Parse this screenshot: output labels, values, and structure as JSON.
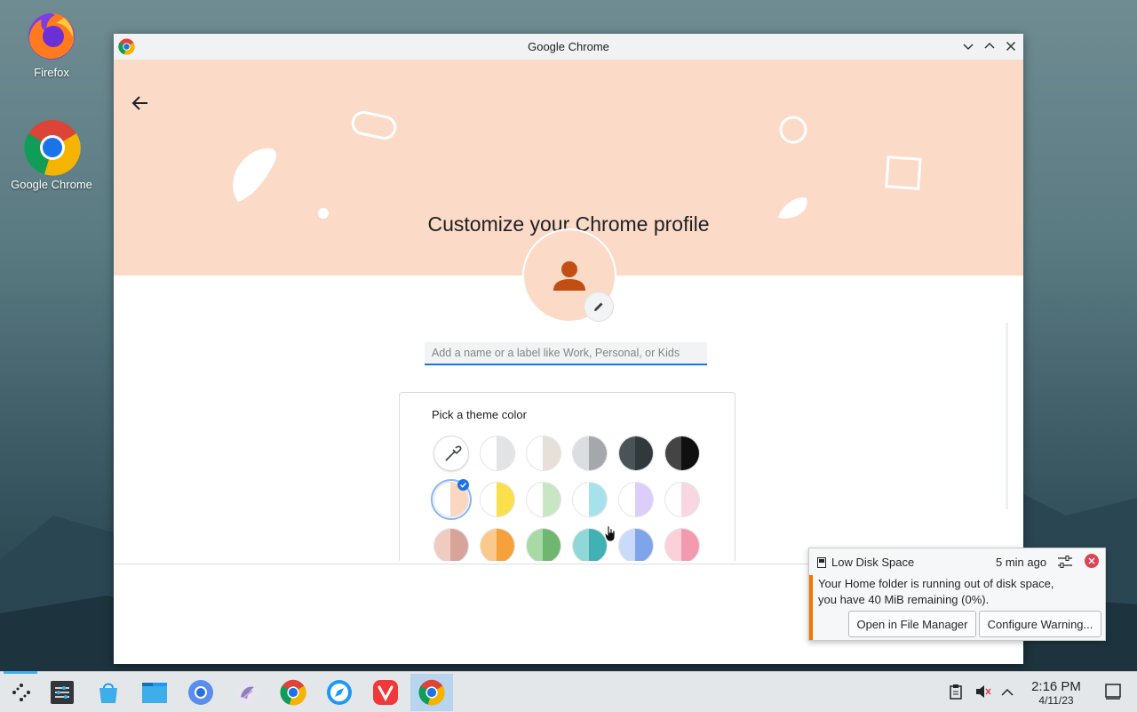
{
  "desktop": {
    "icons": [
      {
        "label": "Firefox",
        "icon": "firefox-icon"
      },
      {
        "label": "Google Chrome",
        "icon": "chrome-icon"
      }
    ]
  },
  "window": {
    "title": "Google Chrome",
    "controls": {
      "minimize": "minimize-icon",
      "maximize": "maximize-icon",
      "close": "close-icon"
    }
  },
  "page": {
    "heading": "Customize your Chrome profile",
    "name_input": {
      "value": "",
      "placeholder": "Add a name or a label like Work, Personal, or Kids"
    },
    "theme": {
      "label": "Pick a theme color",
      "swatches": [
        [
          {
            "left": "#ffffff",
            "right": "#ffffff",
            "type": "custom",
            "icon": "eyedropper-icon"
          },
          {
            "left": "#ffffff",
            "right": "#e2e3e5"
          },
          {
            "left": "#ffffff",
            "right": "#e6e0d8"
          },
          {
            "left": "#dcdde0",
            "right": "#a4a7ac"
          },
          {
            "left": "#4a5358",
            "right": "#32393d"
          },
          {
            "left": "#444444",
            "right": "#101010"
          }
        ],
        [
          {
            "left": "#ffffff",
            "right": "#fbd7c0",
            "selected": true
          },
          {
            "left": "#ffffff",
            "right": "#fbe04c"
          },
          {
            "left": "#ffffff",
            "right": "#c9e6c4"
          },
          {
            "left": "#ffffff",
            "right": "#a6e2ec"
          },
          {
            "left": "#ffffff",
            "right": "#dccdfb"
          },
          {
            "left": "#ffffff",
            "right": "#f9d7e0"
          }
        ],
        [
          {
            "left": "#efcbc0",
            "right": "#d8a39a"
          },
          {
            "left": "#fbc98d",
            "right": "#f7a13d"
          },
          {
            "left": "#a8d9a6",
            "right": "#6fb670"
          },
          {
            "left": "#8fd7d8",
            "right": "#42b1b4"
          },
          {
            "left": "#c9dafb",
            "right": "#7ea5ec"
          },
          {
            "left": "#fbd0d8",
            "right": "#f49aae"
          }
        ]
      ]
    }
  },
  "notification": {
    "title": "Low Disk Space",
    "time": "5 min ago",
    "body_line1": "Your Home folder is running out of disk space,",
    "body_line2": "you have 40 MiB remaining (0%).",
    "actions": {
      "open": "Open in File Manager",
      "configure": "Configure Warning..."
    }
  },
  "taskbar": {
    "apps": [
      "app-launcher-icon",
      "system-settings-icon",
      "discover-icon",
      "file-manager-icon",
      "chromium-icon",
      "kde-app-icon",
      "chrome-icon",
      "safari-like-icon",
      "vivaldi-icon",
      "chrome-active-icon"
    ],
    "time": "2:16 PM",
    "date": "4/11/23"
  },
  "colors": {
    "hero_bg": "#fbdac8",
    "avatar_person": "#c24e12",
    "accent_blue": "#1a73e8",
    "notification_accent": "#f67400"
  }
}
